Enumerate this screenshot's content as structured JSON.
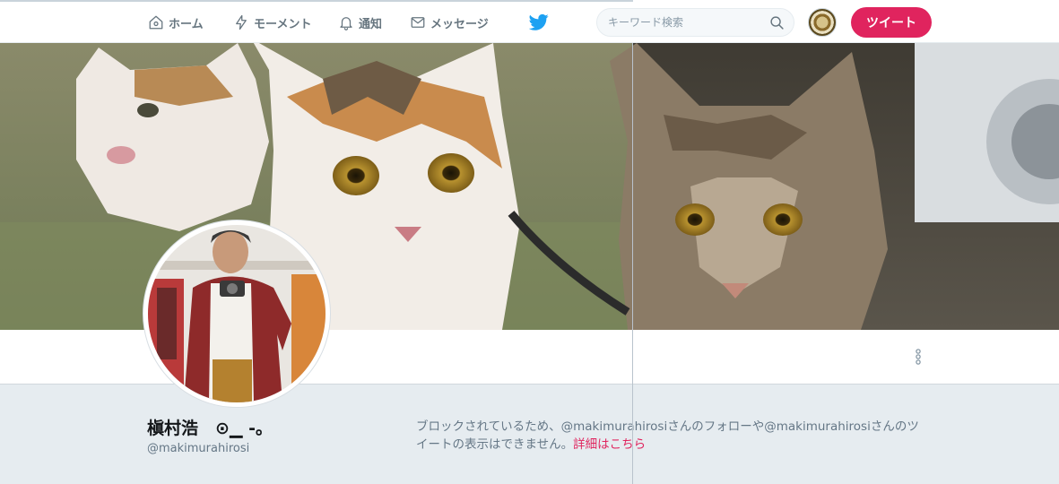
{
  "nav": {
    "home": "ホーム",
    "moments": "モーメント",
    "notifications": "通知",
    "messages": "メッセージ"
  },
  "search": {
    "placeholder": "キーワード検索"
  },
  "tweet_button": "ツイート",
  "profile": {
    "display_name": "槇村浩　⊙▁ ‐。",
    "screen_name": "@makimurahirosi"
  },
  "blocked_message": {
    "text": "ブロックされているため、@makimurahirosiさんのフォローや@makimurahirosiさんのツイートの表示はできません。",
    "link": "詳細はこちら"
  },
  "colors": {
    "accent": "#e0245e",
    "twitter_blue": "#1da1f2",
    "muted_text": "#657786",
    "panel_bg": "#e6ecf0"
  },
  "icons": [
    "home-icon",
    "lightning-icon",
    "bell-icon",
    "envelope-icon",
    "twitter-bird-icon",
    "search-icon",
    "more-vertical-icon"
  ]
}
